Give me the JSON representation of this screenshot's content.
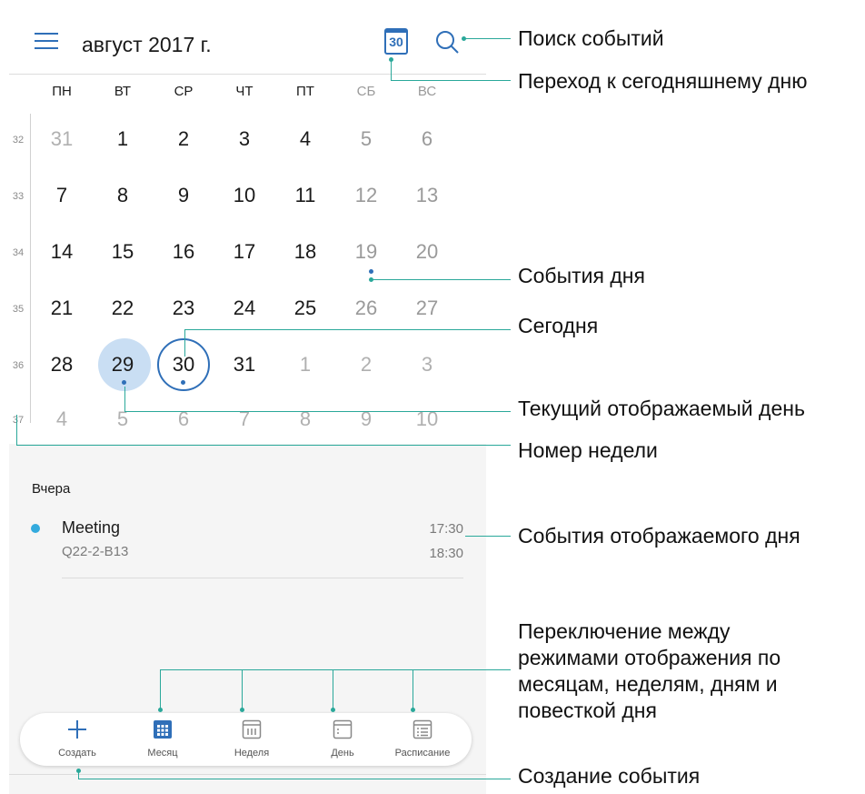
{
  "header": {
    "title": "август 2017 г.",
    "today_icon_day": "30"
  },
  "weekdays": [
    "ПН",
    "ВТ",
    "СР",
    "ЧТ",
    "ПТ",
    "СБ",
    "ВС"
  ],
  "weeks": [
    {
      "num": "32",
      "days": [
        "31",
        "1",
        "2",
        "3",
        "4",
        "5",
        "6"
      ]
    },
    {
      "num": "33",
      "days": [
        "7",
        "8",
        "9",
        "10",
        "11",
        "12",
        "13"
      ]
    },
    {
      "num": "34",
      "days": [
        "14",
        "15",
        "16",
        "17",
        "18",
        "19",
        "20"
      ]
    },
    {
      "num": "35",
      "days": [
        "21",
        "22",
        "23",
        "24",
        "25",
        "26",
        "27"
      ]
    },
    {
      "num": "36",
      "days": [
        "28",
        "29",
        "30",
        "31",
        "1",
        "2",
        "3"
      ]
    },
    {
      "num": "37",
      "days": [
        "4",
        "5",
        "6",
        "7",
        "8",
        "9",
        "10"
      ]
    }
  ],
  "agenda": {
    "section_title": "Вчера",
    "event": {
      "title": "Meeting",
      "location": "Q22-2-B13",
      "start": "17:30",
      "end": "18:30"
    }
  },
  "bottom_nav": {
    "create": "Создать",
    "month": "Месяц",
    "week": "Неделя",
    "day": "День",
    "schedule": "Расписание"
  },
  "annotations": {
    "search": "Поиск событий",
    "go_today": "Переход к сегодняшнему дню",
    "day_events": "События дня",
    "today": "Сегодня",
    "current_day": "Текущий отображаемый день",
    "week_number": "Номер недели",
    "shown_day_events": "События отображаемого дня",
    "view_switch": "Переключение между\nрежимами отображения по\nмесяцам, неделям, дням и\nповесткой дня",
    "create_event": "Создание события"
  },
  "colors": {
    "accent": "#2f6fb8",
    "selected_bg": "#c9def3",
    "event_dot": "#33aadd",
    "callout": "#2aa89a"
  }
}
